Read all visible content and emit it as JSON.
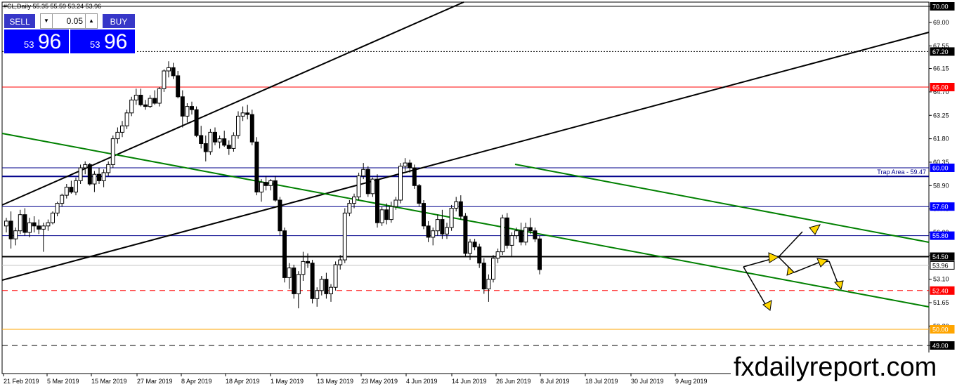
{
  "header": {
    "symbol_info": "#CL,Daily  55.35 55.59 53.24 53.96"
  },
  "trade_panel": {
    "sell_label": "SELL",
    "buy_label": "BUY",
    "lot_value": "0.05",
    "sell_price_small": "53",
    "sell_price_big": "96",
    "buy_price_small": "53",
    "buy_price_big": "96"
  },
  "brand": "fxdailyreport.com",
  "colors": {
    "green_line": "#008000",
    "blue_line": "#00008b",
    "red_line": "#ff0000",
    "orange_line": "#ffa500",
    "arrow_fill": "#ffd700",
    "up_candle": "#ffffff",
    "down_candle": "#000000"
  },
  "chart_data": {
    "type": "candlestick",
    "ylim": [
      48.5,
      70.4
    ],
    "price_ticks": [
      "70.00",
      "69.00",
      "67.55",
      "66.15",
      "64.70",
      "63.25",
      "61.80",
      "60.35",
      "58.90",
      "57.45",
      "56.00",
      "54.55",
      "53.10",
      "51.65",
      "50.20",
      "49.00"
    ],
    "date_labels": [
      "21 Feb 2019",
      "5 Mar 2019",
      "15 Mar 2019",
      "27 Mar 2019",
      "8 Apr 2019",
      "18 Apr 2019",
      "1 May 2019",
      "13 May 2019",
      "23 May 2019",
      "4 Jun 2019",
      "14 Jun 2019",
      "26 Jun 2019",
      "8 Jul 2019",
      "18 Jul 2019",
      "30 Jul 2019",
      "9 Aug 2019"
    ],
    "level_lines": [
      {
        "label": "70.00",
        "value": 70.0,
        "color": "#000000",
        "style": "solid",
        "tag_bg": "#000000",
        "tag_fg": "#ffffff"
      },
      {
        "label": "67.20",
        "value": 67.2,
        "color": "#000000",
        "style": "dotted",
        "tag_bg": "#000000",
        "tag_fg": "#ffffff"
      },
      {
        "label": "65.00",
        "value": 65.0,
        "color": "#ff0000",
        "style": "solid",
        "tag_bg": "#ff0000",
        "tag_fg": "#ffffff"
      },
      {
        "label": "60.00",
        "value": 60.0,
        "color": "#00008b",
        "style": "solid",
        "tag_bg": "#0000ff",
        "tag_fg": "#ffffff"
      },
      {
        "label": "",
        "value": 59.47,
        "color": "#00008b",
        "style": "solid2",
        "tag_bg": "",
        "tag_fg": ""
      },
      {
        "label": "57.60",
        "value": 57.6,
        "color": "#00008b",
        "style": "solid",
        "tag_bg": "#0000ff",
        "tag_fg": "#ffffff"
      },
      {
        "label": "55.80",
        "value": 55.8,
        "color": "#00008b",
        "style": "solid",
        "tag_bg": "#0000ff",
        "tag_fg": "#ffffff"
      },
      {
        "label": "54.50",
        "value": 54.5,
        "color": "#000000",
        "style": "solid2",
        "tag_bg": "#000000",
        "tag_fg": "#ffffff"
      },
      {
        "label": "53.96",
        "value": 53.96,
        "color": "#c0c0c0",
        "style": "solid",
        "tag_bg": "#ffffff",
        "tag_fg": "#000000"
      },
      {
        "label": "52.40",
        "value": 52.4,
        "color": "#ff0000",
        "style": "dashed",
        "tag_bg": "#ff0000",
        "tag_fg": "#ffffff"
      },
      {
        "label": "50.00",
        "value": 50.0,
        "color": "#ffa500",
        "style": "solid",
        "tag_bg": "#ffa500",
        "tag_fg": "#ffffff"
      },
      {
        "label": "49.00",
        "value": 49.0,
        "color": "#000000",
        "style": "dashed",
        "tag_bg": "#000000",
        "tag_fg": "#ffffff"
      }
    ],
    "annotations": [
      {
        "text": "Trap Area - 59.47",
        "value": 59.47
      }
    ],
    "candles": [
      [
        56.4,
        56.9,
        56.0,
        56.7
      ],
      [
        56.7,
        57.3,
        55.0,
        55.6
      ],
      [
        55.6,
        56.3,
        55.2,
        56.1
      ],
      [
        56.1,
        57.4,
        55.9,
        57.1
      ],
      [
        57.1,
        57.5,
        55.8,
        56.0
      ],
      [
        56.0,
        56.9,
        55.7,
        56.6
      ],
      [
        56.6,
        57.0,
        56.0,
        56.4
      ],
      [
        56.4,
        56.8,
        55.9,
        56.2
      ],
      [
        56.2,
        56.6,
        54.8,
        56.4
      ],
      [
        56.4,
        56.8,
        56.1,
        56.6
      ],
      [
        56.6,
        57.3,
        56.5,
        57.2
      ],
      [
        57.2,
        57.9,
        57.0,
        57.8
      ],
      [
        57.8,
        58.4,
        57.6,
        58.3
      ],
      [
        58.3,
        59.0,
        58.1,
        58.8
      ],
      [
        58.8,
        59.2,
        58.4,
        58.5
      ],
      [
        58.5,
        59.4,
        58.3,
        59.2
      ],
      [
        59.2,
        60.2,
        59.0,
        60.0
      ],
      [
        60.0,
        60.4,
        59.6,
        60.2
      ],
      [
        60.2,
        60.3,
        58.9,
        59.0
      ],
      [
        59.0,
        59.8,
        58.5,
        59.6
      ],
      [
        59.6,
        60.0,
        59.0,
        59.2
      ],
      [
        59.2,
        59.9,
        58.8,
        59.7
      ],
      [
        59.7,
        60.4,
        59.5,
        60.2
      ],
      [
        60.2,
        62.0,
        60.0,
        61.8
      ],
      [
        61.8,
        62.5,
        61.5,
        62.2
      ],
      [
        62.2,
        62.9,
        61.9,
        62.6
      ],
      [
        62.6,
        63.6,
        62.4,
        63.4
      ],
      [
        63.4,
        64.4,
        63.2,
        64.2
      ],
      [
        64.2,
        64.9,
        63.9,
        64.5
      ],
      [
        64.5,
        64.9,
        63.8,
        63.9
      ],
      [
        63.9,
        64.2,
        63.6,
        63.8
      ],
      [
        63.8,
        64.5,
        63.7,
        64.3
      ],
      [
        64.3,
        64.8,
        63.9,
        64.0
      ],
      [
        64.0,
        65.0,
        63.8,
        64.9
      ],
      [
        64.9,
        66.1,
        64.7,
        66.0
      ],
      [
        66.0,
        66.6,
        65.6,
        66.2
      ],
      [
        66.2,
        66.5,
        65.5,
        65.7
      ],
      [
        65.7,
        66.0,
        64.3,
        64.4
      ],
      [
        64.4,
        64.8,
        62.5,
        63.2
      ],
      [
        63.2,
        64.0,
        62.8,
        63.8
      ],
      [
        63.8,
        64.1,
        63.3,
        63.6
      ],
      [
        63.6,
        63.8,
        61.9,
        62.0
      ],
      [
        62.0,
        62.6,
        61.2,
        61.5
      ],
      [
        61.5,
        62.0,
        60.4,
        61.0
      ],
      [
        61.0,
        62.4,
        60.8,
        62.2
      ],
      [
        62.2,
        62.5,
        61.4,
        61.6
      ],
      [
        61.6,
        62.0,
        61.2,
        61.8
      ],
      [
        61.8,
        62.3,
        61.3,
        61.4
      ],
      [
        61.4,
        61.7,
        60.8,
        61.2
      ],
      [
        61.2,
        62.2,
        61.0,
        62.0
      ],
      [
        62.0,
        63.5,
        61.8,
        63.2
      ],
      [
        63.2,
        63.8,
        62.9,
        63.4
      ],
      [
        63.4,
        63.9,
        63.0,
        63.3
      ],
      [
        63.3,
        63.6,
        61.4,
        61.6
      ],
      [
        61.6,
        61.9,
        58.3,
        58.5
      ],
      [
        58.5,
        59.3,
        57.9,
        59.1
      ],
      [
        59.1,
        59.5,
        58.6,
        58.9
      ],
      [
        58.9,
        59.3,
        58.6,
        59.2
      ],
      [
        59.2,
        59.5,
        57.9,
        58.0
      ],
      [
        58.0,
        58.2,
        55.8,
        56.1
      ],
      [
        56.1,
        56.3,
        52.9,
        53.2
      ],
      [
        53.2,
        54.1,
        52.5,
        53.8
      ],
      [
        53.8,
        54.0,
        51.9,
        52.2
      ],
      [
        52.2,
        53.6,
        51.3,
        53.4
      ],
      [
        53.4,
        54.8,
        53.0,
        54.2
      ],
      [
        54.2,
        54.7,
        53.8,
        54.1
      ],
      [
        54.1,
        54.3,
        51.6,
        51.9
      ],
      [
        51.9,
        52.6,
        51.4,
        52.4
      ],
      [
        52.4,
        53.3,
        52.1,
        53.1
      ],
      [
        53.1,
        53.5,
        51.9,
        52.2
      ],
      [
        52.2,
        52.8,
        51.7,
        52.6
      ],
      [
        52.6,
        54.2,
        52.4,
        54.0
      ],
      [
        54.0,
        54.6,
        53.7,
        54.3
      ],
      [
        54.3,
        57.5,
        54.1,
        57.2
      ],
      [
        57.2,
        58.0,
        57.0,
        57.8
      ],
      [
        57.8,
        58.4,
        57.5,
        58.2
      ],
      [
        58.2,
        59.7,
        58.0,
        59.5
      ],
      [
        59.5,
        60.3,
        59.3,
        59.9
      ],
      [
        59.9,
        60.1,
        58.2,
        58.4
      ],
      [
        58.4,
        59.4,
        58.2,
        59.3
      ],
      [
        59.3,
        59.6,
        56.3,
        56.6
      ],
      [
        56.6,
        57.6,
        56.4,
        57.4
      ],
      [
        57.4,
        57.8,
        56.5,
        56.8
      ],
      [
        56.8,
        57.9,
        56.6,
        57.6
      ],
      [
        57.6,
        58.2,
        57.4,
        58.0
      ],
      [
        58.0,
        60.3,
        57.8,
        60.1
      ],
      [
        60.1,
        60.6,
        59.8,
        60.3
      ],
      [
        60.3,
        60.5,
        59.7,
        60.0
      ],
      [
        60.0,
        60.2,
        58.7,
        58.9
      ],
      [
        58.9,
        59.0,
        57.6,
        57.8
      ],
      [
        57.8,
        58.0,
        56.2,
        56.4
      ],
      [
        56.4,
        56.7,
        55.4,
        55.7
      ],
      [
        55.7,
        56.3,
        55.2,
        56.1
      ],
      [
        56.1,
        57.1,
        55.8,
        56.8
      ],
      [
        56.8,
        57.4,
        55.6,
        55.9
      ],
      [
        55.9,
        56.6,
        55.6,
        56.3
      ],
      [
        56.3,
        57.7,
        56.1,
        57.5
      ],
      [
        57.5,
        58.2,
        57.3,
        57.9
      ],
      [
        57.9,
        58.3,
        56.8,
        57.0
      ],
      [
        57.0,
        57.2,
        54.5,
        54.7
      ],
      [
        54.7,
        55.6,
        54.3,
        55.4
      ],
      [
        55.4,
        55.6,
        54.9,
        55.1
      ],
      [
        55.1,
        55.3,
        53.8,
        54.1
      ],
      [
        54.1,
        54.4,
        52.2,
        52.5
      ],
      [
        52.5,
        53.4,
        51.7,
        53.1
      ],
      [
        53.1,
        54.6,
        52.9,
        54.4
      ],
      [
        54.4,
        55.0,
        54.1,
        54.8
      ],
      [
        54.8,
        57.1,
        54.6,
        56.9
      ],
      [
        56.9,
        57.2,
        55.0,
        55.2
      ],
      [
        55.2,
        56.0,
        54.5,
        55.8
      ],
      [
        55.8,
        56.3,
        55.6,
        56.1
      ],
      [
        56.1,
        56.6,
        55.2,
        55.4
      ],
      [
        55.4,
        56.6,
        55.2,
        56.3
      ],
      [
        56.3,
        56.9,
        55.9,
        56.1
      ],
      [
        56.1,
        56.3,
        55.4,
        55.6
      ],
      [
        55.6,
        55.8,
        53.4,
        53.7
      ]
    ]
  }
}
